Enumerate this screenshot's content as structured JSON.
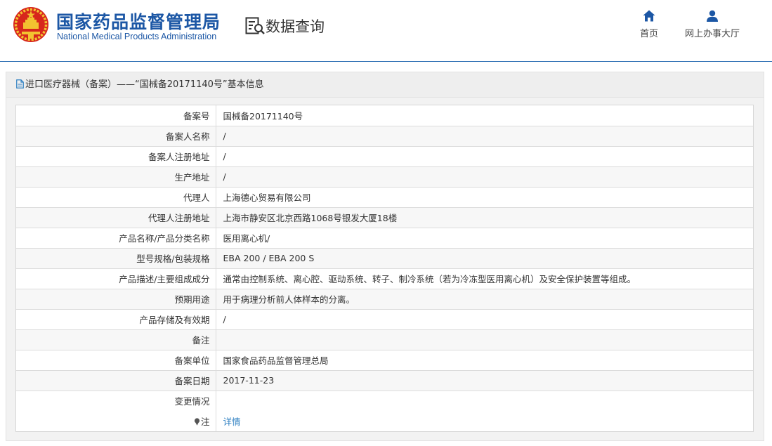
{
  "header": {
    "brand_cn": "国家药品监督管理局",
    "brand_en": "National Medical Products Administration",
    "query_label": "数据查询",
    "nav": [
      {
        "label": "首页",
        "icon": "home-icon"
      },
      {
        "label": "网上办事大厅",
        "icon": "user-icon"
      }
    ]
  },
  "panel": {
    "title": "进口医疗器械（备案）——“国械备20171140号”基本信息"
  },
  "rows": [
    {
      "label": "备案号",
      "value": "国械备20171140号"
    },
    {
      "label": "备案人名称",
      "value": "/"
    },
    {
      "label": "备案人注册地址",
      "value": "/"
    },
    {
      "label": "生产地址",
      "value": "/"
    },
    {
      "label": "代理人",
      "value": "上海德心贸易有限公司"
    },
    {
      "label": "代理人注册地址",
      "value": "上海市静安区北京西路1068号银发大厦18楼"
    },
    {
      "label": "产品名称/产品分类名称",
      "value": "医用离心机/"
    },
    {
      "label": "型号规格/包装规格",
      "value": "EBA 200 / EBA 200 S"
    },
    {
      "label": "产品描述/主要组成成分",
      "value": "通常由控制系统、离心腔、驱动系统、转子、制冷系统（若为冷冻型医用离心机）及安全保护装置等组成。"
    },
    {
      "label": "预期用途",
      "value": "用于病理分析前人体样本的分离。"
    },
    {
      "label": "产品存储及有效期",
      "value": "/"
    },
    {
      "label": "备注",
      "value": ""
    },
    {
      "label": "备案单位",
      "value": "国家食品药品监督管理总局"
    },
    {
      "label": "备案日期",
      "value": "2017-11-23"
    },
    {
      "label": "变更情况",
      "value": ""
    }
  ],
  "note_row": {
    "label": "注",
    "link": "详情"
  },
  "colors": {
    "brand_blue": "#1c57a5",
    "link_blue": "#2d7fc1",
    "emblem_red": "#d7261c",
    "emblem_gold": "#f2c230"
  }
}
